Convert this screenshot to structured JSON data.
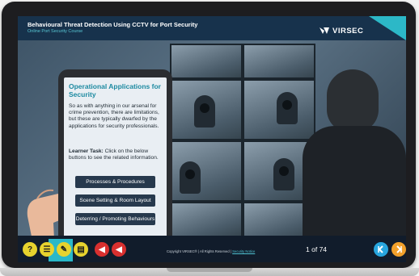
{
  "header": {
    "title": "Behavioural Threat Detection Using CCTV for Port Security",
    "subtitle": "Online Port Security Course",
    "logo_text": "VIRSEC"
  },
  "tablet": {
    "title": "Operational Applications for Security",
    "body": "So as with anything in our arsenal for crime prevention, there are limitations, but these are typically dwarfed by the applications for security professionals.",
    "task_label": "Learner Task:",
    "task_text": " Click on the below buttons to see the related information.",
    "buttons": [
      "Processes & Procedures",
      "Scene Setting & Room Layout",
      "Deterring / Promoting Behaviours"
    ]
  },
  "toolbar": {
    "tools": [
      {
        "icon": "help-icon",
        "glyph": "?"
      },
      {
        "icon": "menu-list-icon",
        "glyph": "☰"
      },
      {
        "icon": "pencil-icon",
        "glyph": "✎"
      },
      {
        "icon": "notes-icon",
        "glyph": "▤"
      },
      {
        "icon": "volume-mute-icon",
        "glyph": "◀"
      },
      {
        "icon": "volume-on-icon",
        "glyph": "◀"
      }
    ],
    "copyright": "Copyright VIRSEC® | All Rights Reserved | ",
    "security_notice": "Security Notice",
    "page_current": "1",
    "page_of": "of",
    "page_total": "74"
  },
  "colors": {
    "accent": "#2cb8c7",
    "header_bg": "#17324c",
    "toolbar_bg": "#111c2b",
    "tablet_title": "#1d8aa1",
    "button_bg": "#27394d"
  }
}
